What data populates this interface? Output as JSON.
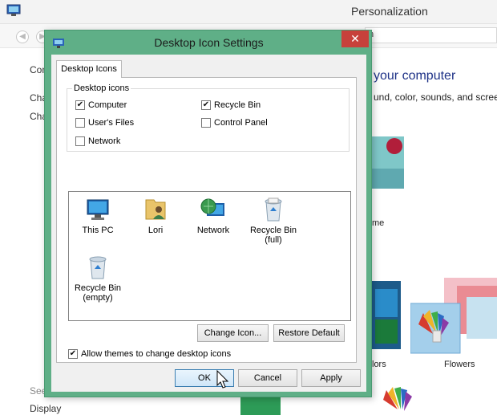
{
  "background": {
    "window_title": "Personalization",
    "address_fragment": "n",
    "side_items": [
      "Con",
      "Cha",
      "Cha"
    ],
    "heading": "your computer",
    "subheading": "und, color, sounds, and screen",
    "theme_label_me": "me",
    "theme_label_olors": "lors",
    "theme_label_flowers": "Flowers",
    "see_also": "See",
    "display_link": "Display"
  },
  "dialog": {
    "title": "Desktop Icon Settings",
    "close_symbol": "✕",
    "tab_label": "Desktop Icons",
    "group_label": "Desktop icons",
    "checkboxes": [
      {
        "label": "Computer",
        "checked": true
      },
      {
        "label": "Recycle Bin",
        "checked": true
      },
      {
        "label": "User's Files",
        "checked": false
      },
      {
        "label": "Control Panel",
        "checked": false
      },
      {
        "label": "Network",
        "checked": false
      }
    ],
    "icons": [
      {
        "label": "This PC",
        "icon": "computer-icon"
      },
      {
        "label": "Lori",
        "icon": "user-folder-icon"
      },
      {
        "label": "Network",
        "icon": "network-icon"
      },
      {
        "label": "Recycle Bin\n(full)",
        "icon": "recycle-bin-full-icon"
      },
      {
        "label": "Recycle Bin\n(empty)",
        "icon": "recycle-bin-empty-icon"
      }
    ],
    "change_icon_label": "Change Icon...",
    "restore_default_label": "Restore Default",
    "allow_themes_label": "Allow themes to change desktop icons",
    "allow_themes_checked": true,
    "ok_label": "OK",
    "cancel_label": "Cancel",
    "apply_label": "Apply"
  },
  "colors": {
    "dialog_frame": "#5faf87",
    "close_button": "#c7413b",
    "heading_blue": "#1e3287"
  }
}
